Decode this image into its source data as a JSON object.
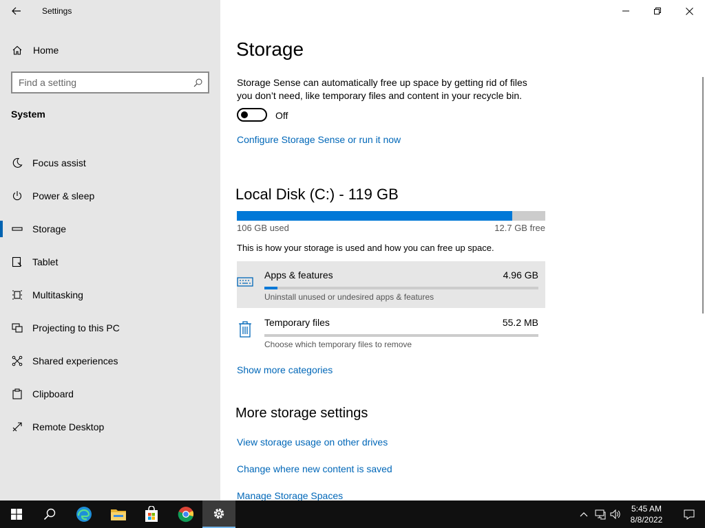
{
  "window": {
    "title": "Settings"
  },
  "sidebar": {
    "home_label": "Home",
    "search_placeholder": "Find a setting",
    "section_title": "System",
    "items": [
      {
        "label": "Focus assist",
        "icon": "moon-icon"
      },
      {
        "label": "Power & sleep",
        "icon": "power-icon"
      },
      {
        "label": "Storage",
        "icon": "storage-icon",
        "active": true
      },
      {
        "label": "Tablet",
        "icon": "tablet-icon"
      },
      {
        "label": "Multitasking",
        "icon": "multitasking-icon"
      },
      {
        "label": "Projecting to this PC",
        "icon": "projecting-icon"
      },
      {
        "label": "Shared experiences",
        "icon": "shared-icon"
      },
      {
        "label": "Clipboard",
        "icon": "clipboard-icon"
      },
      {
        "label": "Remote Desktop",
        "icon": "remote-desktop-icon"
      }
    ]
  },
  "main": {
    "title": "Storage",
    "description": "Storage Sense can automatically free up space by getting rid of files you don’t need, like temporary files and content in your recycle bin.",
    "toggle_state": "Off",
    "configure_link": "Configure Storage Sense or run it now",
    "disk": {
      "title": "Local Disk (C:) - 119 GB",
      "used": "106 GB used",
      "free": "12.7 GB free",
      "used_fraction": 0.893
    },
    "usage_description": "This is how your storage is used and how you can free up space.",
    "categories": [
      {
        "name": "Apps & features",
        "size": "4.96 GB",
        "description": "Uninstall unused or undesired apps & features",
        "fraction": 0.047,
        "icon": "keyboard-icon"
      },
      {
        "name": "Temporary files",
        "size": "55.2 MB",
        "description": "Choose which temporary files to remove",
        "fraction": 0.0,
        "icon": "trash-icon"
      }
    ],
    "show_more_link": "Show more categories",
    "more_title": "More storage settings",
    "more_links": [
      "View storage usage on other drives",
      "Change where new content is saved",
      "Manage Storage Spaces"
    ]
  },
  "taskbar": {
    "time": "5:45 AM",
    "date": "8/8/2022"
  },
  "colors": {
    "accent": "#0078d7",
    "link": "#0067b8",
    "sidebar_bg": "#e6e6e6",
    "taskbar_bg": "#101010"
  }
}
